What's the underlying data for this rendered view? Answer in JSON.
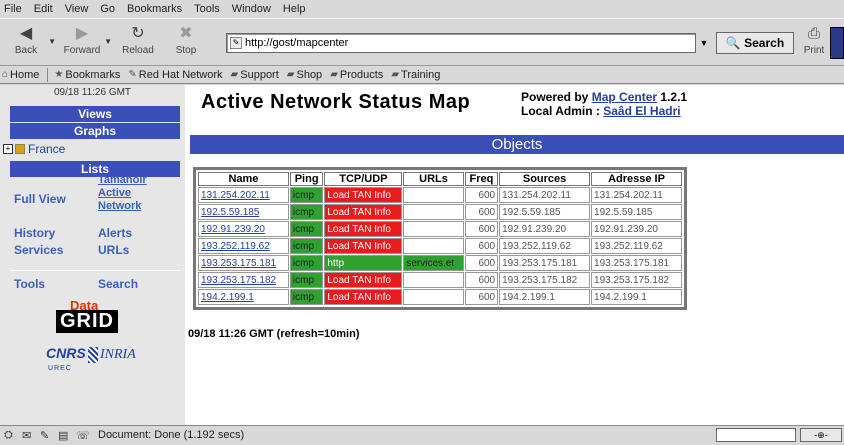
{
  "menu": [
    "File",
    "Edit",
    "View",
    "Go",
    "Bookmarks",
    "Tools",
    "Window",
    "Help"
  ],
  "nav": {
    "back": "Back",
    "forward": "Forward",
    "reload": "Reload",
    "stop": "Stop",
    "url": "http://gost/mapcenter",
    "search": "Search",
    "print": "Print"
  },
  "personal_toolbar": [
    "Home",
    "Bookmarks",
    "Red Hat Network",
    "Support",
    "Shop",
    "Products",
    "Training"
  ],
  "sidebar": {
    "timestamp": "09/18 11:26 GMT",
    "views": "Views",
    "graphs": "Graphs",
    "france": "France",
    "lists": "Lists",
    "full_view": "Full View",
    "tamanoir": "Tamanoir",
    "active": "Active",
    "network": "Network",
    "history": "History",
    "alerts": "Alerts",
    "services": "Services",
    "urls": "URLs",
    "tools": "Tools",
    "search": "Search",
    "logo_data": "Data",
    "logo_grid": "GRID",
    "logo_cnrs": "CNRS",
    "logo_urec": "UREC",
    "logo_inria": "INRIA"
  },
  "header": {
    "title": "Active Network Status Map",
    "powered_label": "Powered by",
    "powered_link": "Map Center",
    "version": "1.2.1",
    "admin_label": "Local Admin :",
    "admin_name": "Saâd El Hadri"
  },
  "objects_title": "Objects",
  "table": {
    "headers": [
      "Name",
      "Ping",
      "TCP/UDP",
      "URLs",
      "Freq",
      "Sources",
      "Adresse IP"
    ],
    "rows": [
      {
        "name": "131.254.202.11",
        "ping": "icmp",
        "tcp": "Load TAN Info",
        "tcp_state": "bad",
        "url": "",
        "freq": "600",
        "src": "131.254.202.11",
        "ip": "131.254.202.11"
      },
      {
        "name": "192.5.59.185",
        "ping": "icmp",
        "tcp": "Load TAN Info",
        "tcp_state": "bad",
        "url": "",
        "freq": "600",
        "src": "192.5.59.185",
        "ip": "192.5.59.185"
      },
      {
        "name": "192.91.239.20",
        "ping": "icmp",
        "tcp": "Load TAN Info",
        "tcp_state": "bad",
        "url": "",
        "freq": "600",
        "src": "192.91.239.20",
        "ip": "192.91.239.20"
      },
      {
        "name": "193.252.119.62",
        "ping": "icmp",
        "tcp": "Load TAN Info",
        "tcp_state": "bad",
        "url": "",
        "freq": "600",
        "src": "193.252.119.62",
        "ip": "193.252.119.62"
      },
      {
        "name": "193.253.175.181",
        "ping": "icmp",
        "tcp": "http",
        "tcp_state": "ok",
        "url": "services.et",
        "freq": "600",
        "src": "193.253.175.181",
        "ip": "193.253.175.181"
      },
      {
        "name": "193.253.175.182",
        "ping": "icmp",
        "tcp": "Load TAN Info",
        "tcp_state": "bad",
        "url": "",
        "freq": "600",
        "src": "193.253.175.182",
        "ip": "193.253.175.182"
      },
      {
        "name": "194.2.199.1",
        "ping": "icmp",
        "tcp": "Load TAN Info",
        "tcp_state": "bad",
        "url": "",
        "freq": "600",
        "src": "194.2.199.1",
        "ip": "194.2.199.1"
      }
    ]
  },
  "refresh_text": "09/18 11:26 GMT (refresh=10min)",
  "status": "Document: Done (1.192 secs)",
  "colors": {
    "nav_blue": "#3b4fb8",
    "ok_green": "#30a030",
    "bad_red": "#e81c1c",
    "link": "#2440a0"
  }
}
